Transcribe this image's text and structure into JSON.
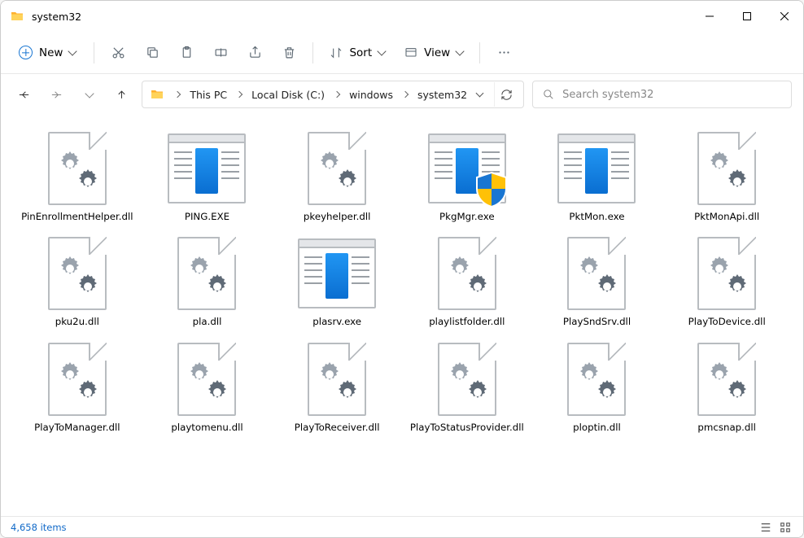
{
  "window": {
    "title": "system32"
  },
  "toolbar": {
    "new_label": "New",
    "sort_label": "Sort",
    "view_label": "View"
  },
  "breadcrumbs": {
    "items": [
      "This PC",
      "Local Disk (C:)",
      "windows",
      "system32"
    ]
  },
  "search": {
    "placeholder": "Search system32"
  },
  "files": {
    "items": [
      {
        "name": "PinEnrollmentHelper.dll",
        "type": "dll"
      },
      {
        "name": "PING.EXE",
        "type": "exe"
      },
      {
        "name": "pkeyhelper.dll",
        "type": "dll"
      },
      {
        "name": "PkgMgr.exe",
        "type": "exe_shield"
      },
      {
        "name": "PktMon.exe",
        "type": "exe"
      },
      {
        "name": "PktMonApi.dll",
        "type": "dll"
      },
      {
        "name": "pku2u.dll",
        "type": "dll"
      },
      {
        "name": "pla.dll",
        "type": "dll"
      },
      {
        "name": "plasrv.exe",
        "type": "exe"
      },
      {
        "name": "playlistfolder.dll",
        "type": "dll"
      },
      {
        "name": "PlaySndSrv.dll",
        "type": "dll"
      },
      {
        "name": "PlayToDevice.dll",
        "type": "dll"
      },
      {
        "name": "PlayToManager.dll",
        "type": "dll"
      },
      {
        "name": "playtomenu.dll",
        "type": "dll"
      },
      {
        "name": "PlayToReceiver.dll",
        "type": "dll"
      },
      {
        "name": "PlayToStatusProvider.dll",
        "type": "dll"
      },
      {
        "name": "ploptin.dll",
        "type": "dll"
      },
      {
        "name": "pmcsnap.dll",
        "type": "dll"
      }
    ]
  },
  "status": {
    "count_label": "4,658 items"
  }
}
